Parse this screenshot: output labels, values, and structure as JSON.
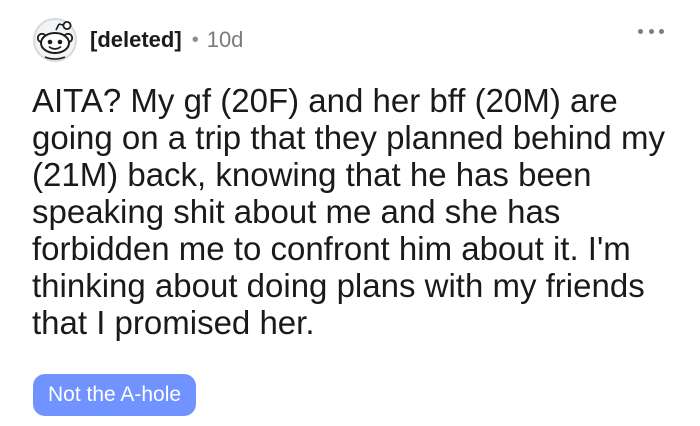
{
  "post": {
    "author": "[deleted]",
    "separator": "•",
    "age": "10d",
    "avatar_icon": "snoo-avatar-icon",
    "menu_icon": "more-horizontal-icon",
    "title": "AITA? My gf (20F) and her bff (20M) are going on a trip that they planned behind my (21M) back, knowing that he has been speaking shit about me and she has forbidden me to confront him about it. I'm thinking about doing plans with my friends that I promised her.",
    "flair": {
      "label": "Not the A-hole",
      "background": "#7193ff",
      "color": "#ffffff"
    }
  }
}
